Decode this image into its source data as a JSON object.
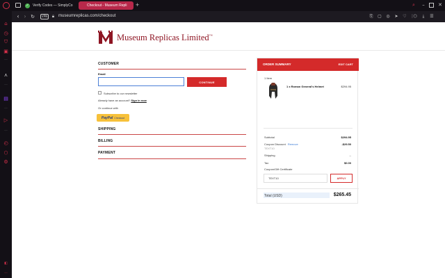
{
  "browser": {
    "tabs": [
      {
        "label": "Verify Codes — SimplyCo",
        "active": false
      },
      {
        "label": "Checkout - Museum Repli",
        "active": true
      }
    ],
    "new_tab_label": "+",
    "vpn_label": "VPN",
    "url": "museumreplicas.com/checkout",
    "accent_color": "#d6304a"
  },
  "site": {
    "brand_name": "Museum Replicas Limited",
    "trademark": "™",
    "brand_color": "#8e1523"
  },
  "checkout": {
    "customer": {
      "title": "CUSTOMER",
      "email_label": "Email",
      "email_value": "",
      "continue_label": "CONTINUE",
      "subscribe_label": "Subscribe to our newsletter",
      "account_prompt": "Already have an account?",
      "sign_in_label": "Sign in now",
      "or_continue": "Or continue with",
      "paypal_label": "PayPal",
      "paypal_sub": "Checkout"
    },
    "shipping_title": "SHIPPING",
    "billing_title": "BILLING",
    "payment_title": "PAYMENT"
  },
  "summary": {
    "title": "ORDER SUMMARY",
    "edit_label": "EDIT CART",
    "item_count": "1 Item",
    "item_name": "1 x Roman General's Helmet",
    "item_price": "$294.95",
    "subtotal_label": "Subtotal",
    "subtotal_value": "$294.95",
    "coupon_label": "Coupon Discount",
    "remove_label": "Remove",
    "coupon_code": "TEXT10",
    "coupon_value": "-$29.50",
    "shipping_label": "Shipping",
    "shipping_value": "--",
    "tax_label": "Tax",
    "tax_value": "$0.00",
    "gift_label": "Coupon/Gift Certificate",
    "gift_value": "TEXT10",
    "apply_label": "APPLY",
    "total_label": "Total (USD)",
    "total_value": "$265.45"
  },
  "icons": {
    "sidebar": [
      "opera-logo-icon",
      "home-icon",
      "history-icon",
      "downloads-icon",
      "messenger-icon",
      "ai-icon",
      "aria-icon",
      "twitch-icon",
      "player-icon",
      "clock-icon",
      "extensions-icon",
      "settings-icon",
      "more-icon"
    ]
  }
}
